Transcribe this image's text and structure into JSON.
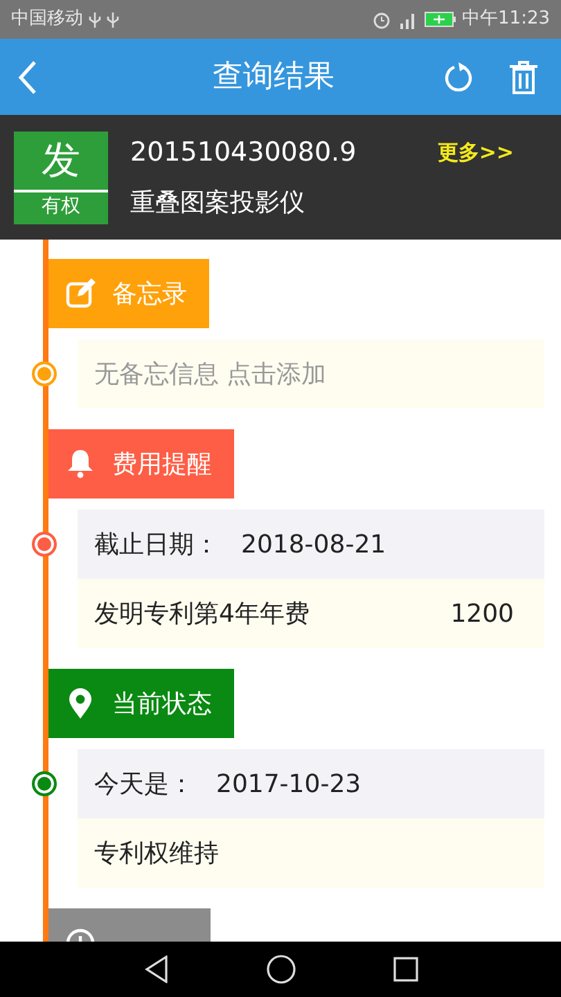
{
  "status_bar": {
    "carrier": "中国移动",
    "time": "中午11:23"
  },
  "header": {
    "title": "查询结果"
  },
  "patent": {
    "badge_char": "发",
    "badge_status": "有权",
    "number": "201510430080.9",
    "name": "重叠图案投影仪",
    "more": "更多>>"
  },
  "sections": [
    {
      "kind": "memo",
      "title": "备忘录",
      "color": "#ffa10a",
      "rows": [
        {
          "kind": "hint",
          "text": "无备忘信息 点击添加"
        }
      ]
    },
    {
      "kind": "fee",
      "title": "费用提醒",
      "color": "#fe5e45",
      "rows": [
        {
          "kind": "date",
          "label": "截止日期：",
          "value": "2018-08-21"
        },
        {
          "kind": "line",
          "text": "发明专利第4年年费",
          "amount": "1200"
        }
      ]
    },
    {
      "kind": "status",
      "title": "当前状态",
      "color": "#0a8a12",
      "rows": [
        {
          "kind": "date",
          "label": "今天是：",
          "value": "2017-10-23"
        },
        {
          "kind": "line",
          "text": "专利权维持"
        }
      ]
    },
    {
      "kind": "history",
      "color": "#8c8c8c"
    }
  ]
}
